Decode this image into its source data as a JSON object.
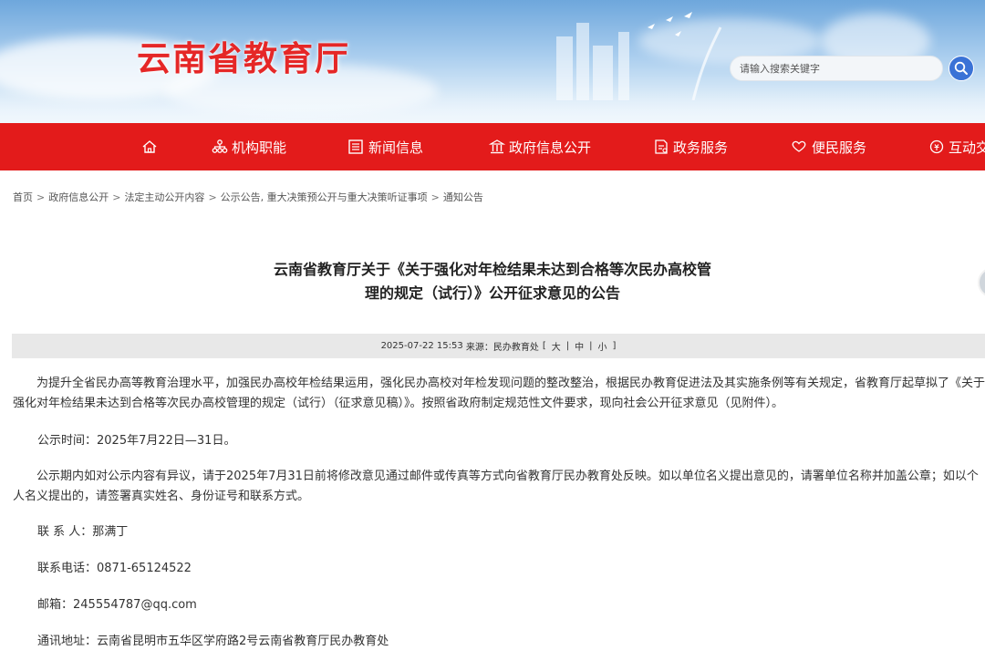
{
  "header": {
    "site_title": "云南省教育厅",
    "search_placeholder": "请输入搜索关键字"
  },
  "nav": {
    "items": [
      {
        "label": "机构职能",
        "icon": "org-chart-icon"
      },
      {
        "label": "新闻信息",
        "icon": "newspaper-icon"
      },
      {
        "label": "政府信息公开",
        "icon": "building-icon"
      },
      {
        "label": "政务服务",
        "icon": "document-icon"
      },
      {
        "label": "便民服务",
        "icon": "heart-hand-icon"
      },
      {
        "label": "互动交",
        "icon": "circle-dollar-icon"
      }
    ]
  },
  "breadcrumb": [
    "首页",
    "政府信息公开",
    "法定主动公开内容",
    "公示公告, 重大决策预公开与重大决策听证事项",
    "通知公告"
  ],
  "article": {
    "title_line1": "云南省教育厅关于《关于强化对年检结果未达到合格等次民办高校管",
    "title_line2": "理的规定（试行）》公开征求意见的公告",
    "meta": {
      "datetime": "2025-07-22 15:53",
      "source_label": "来源：",
      "source": "民办教育处",
      "size_open": "[",
      "size_large": "大",
      "size_medium": "中",
      "size_small": "小",
      "size_close": "]"
    },
    "paragraphs": {
      "p1": "为提升全省民办高等教育治理水平，加强民办高校年检结果运用，强化民办高校对年检发现问题的整改整治，根据民办教育促进法及其实施条例等有关规定，省教育厅起草拟了《关于强化对年检结果未达到合格等次民办高校管理的规定（试行）（征求意见稿）》。按照省政府制定规范性文件要求，现向社会公开征求意见（见附件）。",
      "p2": "公示时间：2025年7月22日—31日。",
      "p3": "公示期内如对公示内容有异议，请于2025年7月31日前将修改意见通过邮件或传真等方式向省教育厅民办教育处反映。如以单位名义提出意见的，请署单位名称并加盖公章；如以个人名义提出的，请签署真实姓名、身份证号和联系方式。",
      "contact": "联 系 人：那满丁",
      "phone": "联系电话：0871-65124522",
      "email": "邮箱：245554787@qq.com",
      "address": "通讯地址：云南省昆明市五华区学府路2号云南省教育厅民办教育处"
    }
  },
  "colors": {
    "brand_red": "#e31b1b",
    "title_red": "#e52727",
    "search_blue": "#3a72d6"
  }
}
